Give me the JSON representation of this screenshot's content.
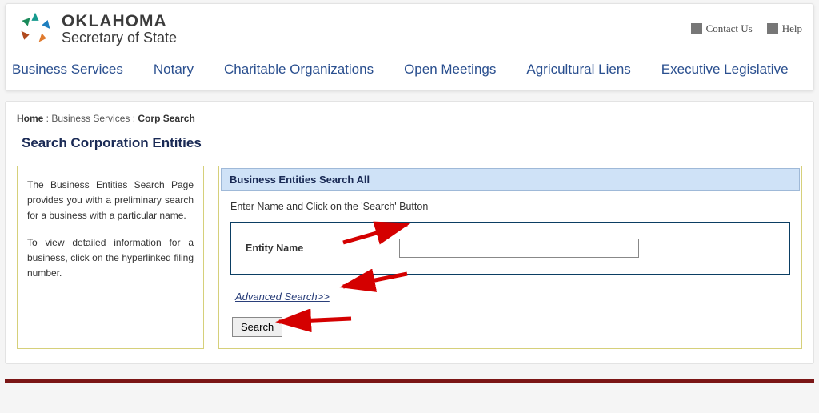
{
  "brand": {
    "line1": "OKLAHOMA",
    "line2": "Secretary of State"
  },
  "top_links": {
    "contact": "Contact Us",
    "help": "Help"
  },
  "nav": {
    "items": [
      "Business Services",
      "Notary",
      "Charitable Organizations",
      "Open Meetings",
      "Agricultural Liens",
      "Executive Legislative"
    ]
  },
  "breadcrumb": {
    "home": "Home",
    "mid": "Business Services",
    "current": "Corp Search",
    "sep": " : "
  },
  "page_title": "Search Corporation Entities",
  "side": {
    "p1": "The Business Entities Search Page provides you with a preliminary search for a business with a particular name.",
    "p2": "To view detailed information for a business, click on the hyperlinked filing number."
  },
  "panel": {
    "header": "Business Entities Search All",
    "instruction": "Enter Name and Click on the 'Search' Button",
    "field_label": "Entity Name",
    "input_value": "",
    "advanced": "Advanced Search>>",
    "search_btn": "Search"
  }
}
